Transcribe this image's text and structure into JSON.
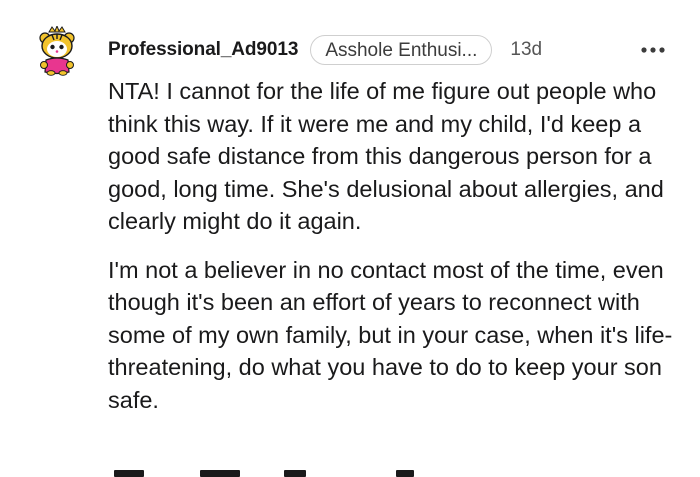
{
  "comment": {
    "author": "Professional_Ad9013",
    "flair": "Asshole Enthusi...",
    "age": "13d",
    "avatar_icon": "tiger-snoo-avatar-icon",
    "more_icon": "more-options-icon",
    "paragraphs": [
      "NTA! I cannot for the life of me figure out people who think this way. If it were me and my child, I'd keep a good safe distance from this dangerous person for a good, long time. She's delusional about allergies, and clearly might do it again.",
      "I'm not a believer in no contact most of the time, even though it's been an effort of years to reconnect with some of my own family, but in your case, when it's life-threatening, do what you have to do to keep your son safe."
    ]
  },
  "colors": {
    "text": "#1a1a1b",
    "flair_border": "#cfcfcf",
    "muted": "#555555",
    "avatar_yellow": "#f2c32c",
    "avatar_pink": "#e8368f"
  }
}
